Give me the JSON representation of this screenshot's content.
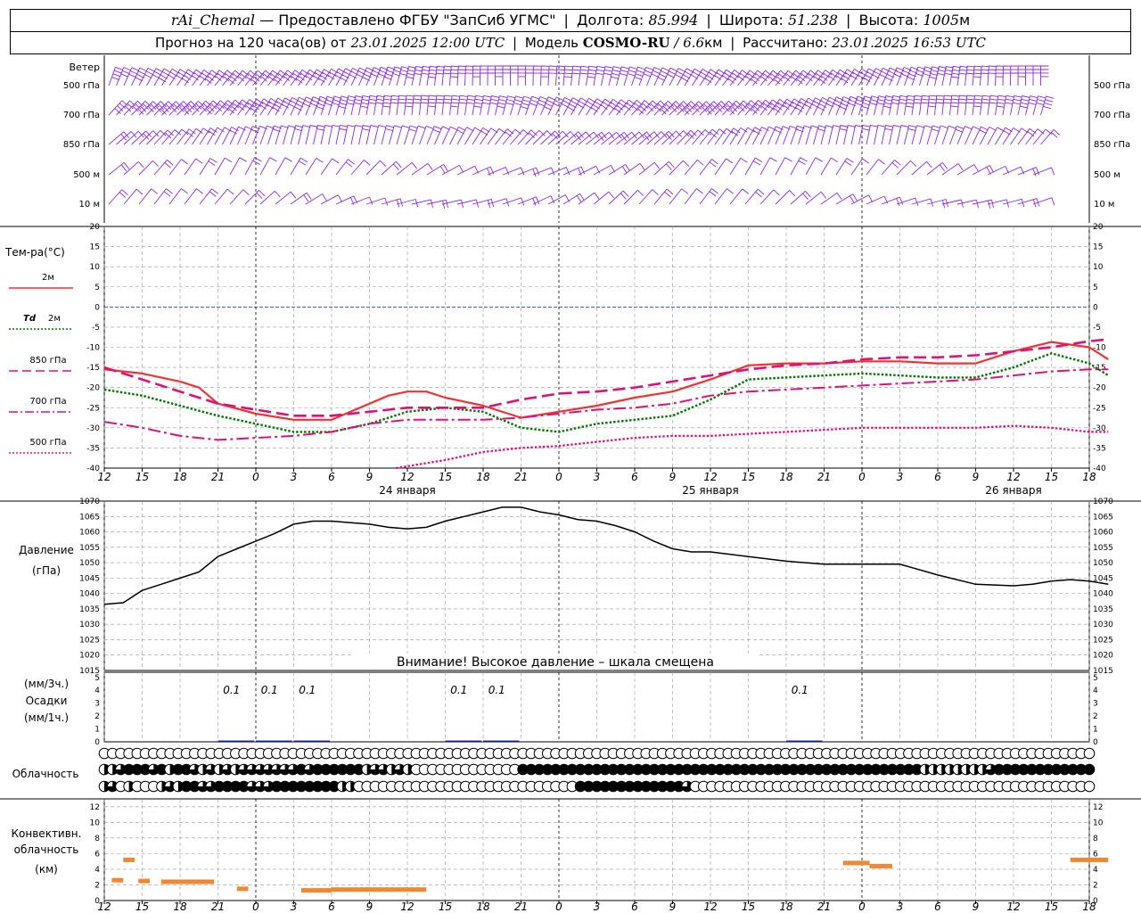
{
  "header": {
    "station": "rAi_Chemal",
    "dash": " — ",
    "provider": "Предоставлено ФГБУ \"ЗапСиб УГМС\"",
    "lon_label": "Долгота:",
    "lon": "85.994",
    "lat_label": "Широта:",
    "lat": "51.238",
    "alt_label": "Высота:",
    "alt": "1005",
    "alt_unit": "м",
    "forecast_prefix": "Прогноз на 120 часа(ов) от",
    "init_time": "23.01.2025 12:00 UTC",
    "model_label": "Модель",
    "model": "COSMO-RU",
    "model_res": "6.6",
    "model_res_unit": "км",
    "calc_label": "Рассчитано:",
    "calc_time": "23.01.2025 16:53 UTC"
  },
  "colors": {
    "wind": "#8a2be2",
    "t2m": "#ee3333",
    "td": "#007700",
    "t850": "#dd1177",
    "t700": "#dd1177",
    "t500": "#dd1177",
    "zero_line": "#3355cc",
    "pressure": "#000000",
    "precip": "#1a1aa0",
    "convective": "#ee8833",
    "grid": "#999999"
  },
  "axis": {
    "hour_labels": [
      "12",
      "15",
      "18",
      "21",
      "0",
      "3",
      "6",
      "9",
      "12",
      "15",
      "18",
      "21",
      "0",
      "3",
      "6",
      "9",
      "12",
      "15",
      "18",
      "21",
      "0",
      "3",
      "6",
      "9",
      "12",
      "15",
      "18"
    ],
    "date_labels": [
      {
        "label": "24 января",
        "at_step": 8
      },
      {
        "label": "25 января",
        "at_step": 16
      },
      {
        "label": "26 января",
        "at_step": 24
      }
    ],
    "midnight_steps": [
      4,
      12,
      20
    ]
  },
  "wind": {
    "title": "Ветер",
    "levels": [
      "500 гПа",
      "700 гПа",
      "850 гПа",
      "500 м",
      "10  м"
    ]
  },
  "temperature": {
    "title": "Тем-ра(°C)",
    "legend": [
      {
        "label": "2м",
        "style": "solid",
        "key": "t2m"
      },
      {
        "label": "Td",
        "label2": "2м",
        "style": "dotted",
        "key": "td"
      },
      {
        "label": "850 гПа",
        "style": "dash",
        "key": "t850"
      },
      {
        "label": "700 гПа",
        "style": "dashdot",
        "key": "t700"
      },
      {
        "label": "500 гПа",
        "style": "dotfine",
        "key": "t500"
      }
    ],
    "ticks": [
      20,
      15,
      10,
      5,
      0,
      -5,
      -10,
      -15,
      -20,
      -25,
      -30,
      -35,
      -40
    ],
    "ylim": [
      -40,
      20
    ]
  },
  "pressure": {
    "title": "Давление",
    "unit": "(гПа)",
    "ticks": [
      1070,
      1065,
      1060,
      1055,
      1050,
      1045,
      1040,
      1035,
      1030,
      1025,
      1020,
      1015
    ],
    "ylim": [
      1015,
      1070
    ],
    "warning": "Внимание! Высокое давление – шкала смещена"
  },
  "precip": {
    "label1": "(мм/3ч.)",
    "label2": "Осадки",
    "label3": "(мм/1ч.)",
    "ticks": [
      5,
      4,
      3,
      2,
      1,
      0
    ],
    "annotations": [
      {
        "step": 3.5,
        "text": "0.1"
      },
      {
        "step": 4.5,
        "text": "0.1"
      },
      {
        "step": 5.5,
        "text": "0.1"
      },
      {
        "step": 9.5,
        "text": "0.1"
      },
      {
        "step": 10.5,
        "text": "0.1"
      },
      {
        "step": 18.5,
        "text": "0.1"
      }
    ]
  },
  "cloud": {
    "title": "Облачность",
    "rows": [
      [
        0,
        0,
        0,
        0,
        0,
        0,
        0,
        0,
        0,
        0,
        0,
        0,
        0,
        0,
        0,
        0,
        0,
        0,
        0,
        0,
        0,
        0,
        0,
        0,
        0,
        0,
        0,
        0,
        0,
        0,
        0,
        0,
        0,
        0,
        0,
        0,
        0,
        0,
        0,
        0,
        0,
        0,
        0,
        0,
        0,
        0,
        0,
        0,
        0,
        0,
        0,
        0,
        0,
        0,
        0,
        0,
        0,
        0,
        0,
        0,
        0,
        0,
        0,
        0,
        0,
        0,
        0,
        0,
        0,
        0,
        0,
        0,
        0,
        0,
        0,
        0,
        0,
        0,
        0,
        0,
        0,
        0,
        0,
        0,
        0,
        0,
        0,
        0,
        0,
        0,
        0,
        0,
        0,
        0,
        0,
        0,
        0,
        0,
        0,
        0,
        0,
        0,
        0,
        0,
        0,
        0,
        0,
        0,
        0,
        0,
        0,
        0,
        0,
        0,
        0,
        0,
        0,
        0,
        0,
        0,
        0
      ],
      [
        2,
        2,
        3,
        4,
        4,
        4,
        3,
        4,
        2,
        4,
        4,
        3,
        2,
        3,
        2,
        3,
        2,
        3,
        3,
        3,
        3,
        3,
        3,
        3,
        4,
        3,
        4,
        4,
        4,
        4,
        4,
        4,
        2,
        3,
        3,
        2,
        3,
        2,
        0,
        0,
        0,
        0,
        0,
        0,
        0,
        0,
        0,
        0,
        0,
        0,
        0,
        4,
        4,
        4,
        4,
        4,
        4,
        4,
        4,
        4,
        4,
        4,
        4,
        4,
        4,
        4,
        4,
        4,
        4,
        4,
        4,
        4,
        4,
        4,
        4,
        4,
        4,
        4,
        4,
        4,
        4,
        4,
        4,
        4,
        4,
        4,
        4,
        4,
        4,
        4,
        4,
        4,
        4,
        4,
        4,
        4,
        4,
        4,
        4,
        4,
        2,
        2,
        2,
        2,
        2,
        2,
        2,
        2,
        3,
        4,
        4,
        4,
        4,
        4,
        4,
        4,
        4,
        4,
        4,
        4,
        4
      ],
      [
        2,
        3,
        0,
        2,
        0,
        0,
        0,
        2,
        3,
        2,
        4,
        4,
        3,
        3,
        4,
        4,
        4,
        4,
        3,
        3,
        3,
        4,
        4,
        4,
        4,
        4,
        4,
        4,
        4,
        2,
        2,
        0,
        0,
        0,
        0,
        0,
        0,
        0,
        0,
        0,
        0,
        0,
        0,
        0,
        0,
        0,
        0,
        0,
        0,
        0,
        0,
        0,
        0,
        0,
        0,
        0,
        0,
        0,
        4,
        4,
        4,
        4,
        4,
        4,
        4,
        4,
        4,
        4,
        4,
        4,
        4,
        3,
        0,
        0,
        0,
        0,
        0,
        0,
        0,
        0,
        0,
        0,
        0,
        0,
        0,
        0,
        0,
        0,
        0,
        0,
        0,
        0,
        0,
        0,
        0,
        0,
        0,
        0,
        0,
        0,
        0,
        0,
        0,
        0,
        0,
        0,
        0,
        0,
        0,
        0,
        0,
        0,
        0,
        0,
        0,
        0,
        0,
        0,
        0,
        0,
        0
      ]
    ]
  },
  "convective": {
    "title1": "Конвективн.",
    "title2": "облачность",
    "title3": "(км)",
    "ticks": [
      12,
      10,
      8,
      6,
      4,
      2,
      0
    ],
    "ylim": [
      0,
      13
    ]
  },
  "chart_data": {
    "type": "line",
    "x_unit": "часы UTC от 23.01.2025 12:00",
    "x_step_hours": 3,
    "steps": 27,
    "series": [
      {
        "name": "2м",
        "key": "t2m",
        "x": [
          0,
          1,
          2,
          2.5,
          3,
          4,
          5,
          6,
          7,
          7.5,
          8,
          8.5,
          9,
          10,
          11,
          12,
          13,
          14,
          15,
          16,
          17,
          18,
          19,
          20,
          21,
          22,
          23,
          24,
          25,
          26,
          26.5
        ],
        "y": [
          -15.5,
          -16.5,
          -18.5,
          -20,
          -24,
          -26.5,
          -28,
          -28,
          -24,
          -22,
          -21,
          -21,
          -22.5,
          -24.5,
          -27.5,
          -26,
          -24.5,
          -22.5,
          -21,
          -18,
          -14.5,
          -14,
          -14,
          -13.5,
          -13.5,
          -14,
          -14,
          -11,
          -8.7,
          -10,
          -13
        ]
      },
      {
        "name": "Td 2м",
        "key": "td",
        "x": [
          0,
          1,
          2,
          3,
          4,
          5,
          6,
          7,
          8,
          9,
          10,
          11,
          12,
          13,
          14,
          15,
          16,
          17,
          18,
          19,
          20,
          21,
          22,
          23,
          24,
          25,
          26,
          26.5
        ],
        "y": [
          -20.5,
          -22,
          -24.5,
          -27,
          -29,
          -31,
          -31,
          -29,
          -26,
          -25,
          -26,
          -30,
          -31,
          -29,
          -28,
          -27,
          -23,
          -18,
          -17.5,
          -17,
          -16.5,
          -17,
          -17.5,
          -17.5,
          -15,
          -11.5,
          -14,
          -17
        ]
      },
      {
        "name": "850 гПа",
        "key": "t850",
        "x": [
          0,
          1,
          2,
          3,
          4,
          5,
          6,
          7,
          8,
          9,
          10,
          11,
          12,
          13,
          14,
          15,
          16,
          17,
          18,
          19,
          20,
          21,
          22,
          23,
          24,
          25,
          26,
          26.5
        ],
        "y": [
          -15,
          -18,
          -21,
          -24,
          -25.5,
          -27,
          -27,
          -26,
          -25,
          -25,
          -25,
          -23,
          -21.5,
          -21,
          -20,
          -18.5,
          -17,
          -15.5,
          -14.5,
          -14,
          -13,
          -12.5,
          -12.5,
          -12,
          -11,
          -10,
          -8.5,
          -8
        ]
      },
      {
        "name": "700 гПа",
        "key": "t700",
        "x": [
          0,
          1,
          2,
          3,
          4,
          5,
          6,
          7,
          8,
          9,
          10,
          11,
          12,
          13,
          14,
          15,
          16,
          17,
          18,
          19,
          20,
          21,
          22,
          23,
          24,
          25,
          26,
          26.5
        ],
        "y": [
          -28.5,
          -30,
          -32,
          -33,
          -32.5,
          -32,
          -31,
          -29,
          -28,
          -28,
          -28,
          -27.5,
          -26.5,
          -25.5,
          -25,
          -24,
          -22,
          -21,
          -20.5,
          -20,
          -19.5,
          -19,
          -18.5,
          -18,
          -17,
          -16,
          -15.5,
          -15.5
        ]
      },
      {
        "name": "500 гПа",
        "key": "t500",
        "x": [
          7.7,
          9,
          10,
          11,
          12,
          13,
          14,
          15,
          16,
          17,
          18,
          19,
          20,
          21,
          22,
          23,
          24,
          25,
          26,
          26.5
        ],
        "y": [
          -40,
          -38,
          -36,
          -35,
          -34.5,
          -33.5,
          -32.5,
          -32,
          -32,
          -31.5,
          -31,
          -30.5,
          -30,
          -30,
          -30,
          -30,
          -29.5,
          -30,
          -31,
          -31
        ]
      },
      {
        "name": "Давление",
        "key": "pressure",
        "x": [
          0,
          0.5,
          1,
          1.5,
          2,
          2.5,
          3,
          3.5,
          4,
          4.5,
          5,
          5.5,
          6,
          7,
          7.5,
          8,
          8.5,
          9,
          9.5,
          10,
          10.5,
          11,
          11.5,
          12,
          12.5,
          13,
          13.5,
          14,
          14.5,
          15,
          15.5,
          16,
          17,
          18,
          19,
          20,
          21,
          22,
          23,
          24,
          24.5,
          25,
          25.5,
          26,
          26.5
        ],
        "y": [
          1036.5,
          1037,
          1041,
          1043,
          1045,
          1047,
          1052,
          1054.5,
          1057,
          1059.5,
          1062.5,
          1063.5,
          1063.5,
          1062.5,
          1061.5,
          1061,
          1061.5,
          1063.5,
          1065,
          1066.5,
          1068,
          1068,
          1066.5,
          1065.5,
          1064,
          1063.5,
          1062,
          1060,
          1057,
          1054.5,
          1053.5,
          1053.5,
          1052,
          1050.5,
          1049.5,
          1049.5,
          1049.5,
          1046,
          1043,
          1042.5,
          1043,
          1044,
          1044.5,
          1044,
          1043
        ]
      },
      {
        "name": "Осадки",
        "key": "precip",
        "x": [
          3.5,
          4.5,
          5.5,
          9.5,
          10.5,
          18.5
        ],
        "y": [
          0.1,
          0.1,
          0.1,
          0.1,
          0.1,
          0.1
        ]
      }
    ],
    "convective_segments": [
      {
        "x1": 0.2,
        "x2": 0.5,
        "y": 2.6
      },
      {
        "x1": 0.5,
        "x2": 0.8,
        "y": 5.2
      },
      {
        "x1": 0.9,
        "x2": 1.2,
        "y": 2.5
      },
      {
        "x1": 1.5,
        "x2": 2.9,
        "y": 2.4
      },
      {
        "x1": 3.5,
        "x2": 3.8,
        "y": 1.5
      },
      {
        "x1": 5.2,
        "x2": 6.0,
        "y": 1.3
      },
      {
        "x1": 6.0,
        "x2": 8.5,
        "y": 1.4
      },
      {
        "x1": 19.5,
        "x2": 20.2,
        "y": 4.8
      },
      {
        "x1": 20.2,
        "x2": 20.8,
        "y": 4.4
      },
      {
        "x1": 25.5,
        "x2": 26.5,
        "y": 5.2
      }
    ]
  }
}
